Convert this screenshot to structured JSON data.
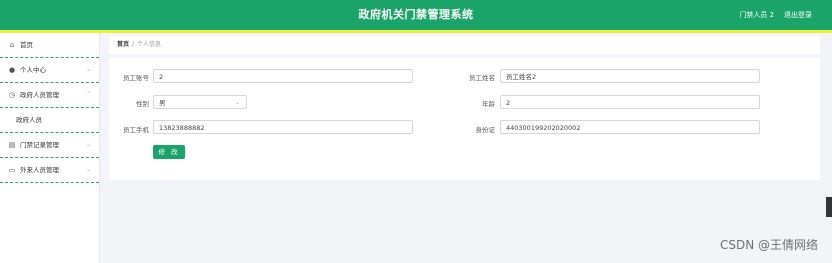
{
  "header": {
    "title": "政府机关门禁管理系统",
    "user_label": "门禁人员 2",
    "logout_label": "退出登录"
  },
  "sidebar": {
    "items": [
      {
        "label": "首页",
        "icon": "home-icon"
      },
      {
        "label": "个人中心",
        "icon": "user-icon"
      },
      {
        "label": "政府人员管理",
        "icon": "clock-icon"
      },
      {
        "label": "政府人员",
        "icon": ""
      },
      {
        "label": "门禁记录管理",
        "icon": "list-icon"
      },
      {
        "label": "外来人员管理",
        "icon": "card-icon"
      }
    ]
  },
  "breadcrumb": {
    "home": "首页",
    "sep": "/",
    "current": "个人信息"
  },
  "form": {
    "emp_no_label": "员工账号",
    "emp_no_value": "2",
    "emp_name_label": "员工姓名",
    "emp_name_value": "员工姓名2",
    "gender_label": "性别",
    "gender_value": "男",
    "age_label": "年龄",
    "age_value": "2",
    "phone_label": "员工手机",
    "phone_value": "13823888882",
    "idcard_label": "身份证",
    "idcard_value": "440300199202020002",
    "submit_label": "修 改"
  },
  "watermark": "CSDN @王倩网络",
  "colors": {
    "primary": "#1ba46a",
    "accent": "#e9f13a"
  }
}
